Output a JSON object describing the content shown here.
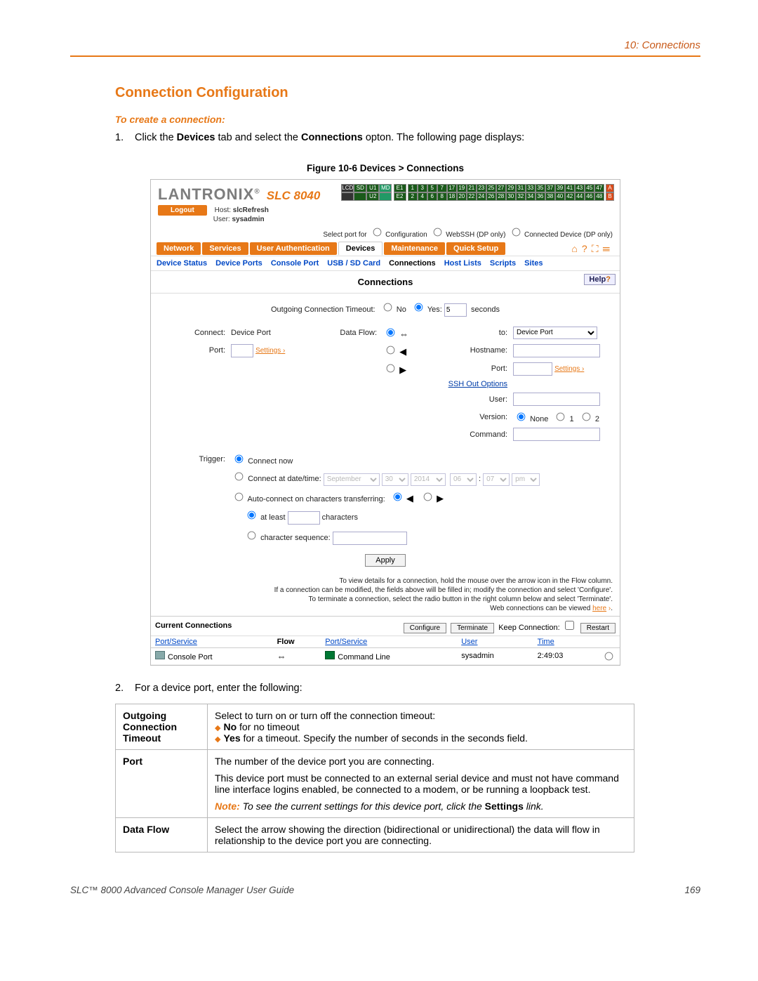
{
  "chapter": "10: Connections",
  "section_title": "Connection Configuration",
  "subhead": "To create a connection:",
  "step1": {
    "num": "1.",
    "pre": "Click the ",
    "b1": "Devices",
    "mid": " tab and select the ",
    "b2": "Connections",
    "post": " opton. The following page displays:"
  },
  "figcap": "Figure 10-6  Devices > Connections",
  "shot": {
    "logo_brand": "LANTRONIX",
    "logo_model": "SLC 8040",
    "logout": "Logout",
    "host_lbl": "Host:",
    "host_val": "slcRefresh",
    "user_lbl": "User:",
    "user_val": "sysadmin",
    "grid": {
      "lcd": "LCD",
      "sd": "SD",
      "u1": "U1",
      "u2": "U2",
      "md": "MD",
      "e1": "E1",
      "e2": "E2",
      "row1": [
        "1",
        "3",
        "5",
        "7",
        "17",
        "19",
        "21",
        "23",
        "25",
        "27",
        "29",
        "31",
        "33",
        "35",
        "37",
        "39",
        "41",
        "43",
        "45",
        "47"
      ],
      "row2": [
        "2",
        "4",
        "6",
        "8",
        "18",
        "20",
        "22",
        "24",
        "26",
        "28",
        "30",
        "32",
        "34",
        "36",
        "38",
        "40",
        "42",
        "44",
        "46",
        "48"
      ],
      "capA": "A",
      "capB": "B"
    },
    "selport": {
      "lbl": "Select port for",
      "o1": "Configuration",
      "o2": "WebSSH (DP only)",
      "o3": "Connected Device (DP only)"
    },
    "tabs": [
      "Network",
      "Services",
      "User Authentication",
      "Devices",
      "Maintenance",
      "Quick Setup"
    ],
    "tab_current": 3,
    "subtabs": [
      "Device Status",
      "Device Ports",
      "Console Port",
      "USB / SD Card",
      "Connections",
      "Host Lists",
      "Scripts",
      "Sites"
    ],
    "subtab_current": 4,
    "panel_title": "Connections",
    "help": "Help",
    "oct": {
      "lbl": "Outgoing Connection Timeout:",
      "no": "No",
      "yes": "Yes:",
      "val": "5",
      "unit": "seconds"
    },
    "left": {
      "connect_lbl": "Connect:",
      "connect_val": "Device Port",
      "port_lbl": "Port:",
      "settings": "Settings"
    },
    "flow_lbl": "Data Flow:",
    "right": {
      "to_lbl": "to:",
      "to_val": "Device Port",
      "host_lbl": "Hostname:",
      "port_lbl": "Port:",
      "settings": "Settings",
      "sshopt": "SSH Out Options",
      "user_lbl": "User:",
      "ver_lbl": "Version:",
      "ver_none": "None",
      "ver_1": "1",
      "ver_2": "2",
      "cmd_lbl": "Command:"
    },
    "trigger": {
      "lbl": "Trigger:",
      "now": "Connect now",
      "at": "Connect at date/time:",
      "month": "September",
      "day": "30",
      "year": "2014",
      "hh": "06",
      "mm": "07",
      "ampm": "pm",
      "auto": "Auto-connect on characters transferring:",
      "atleast": "at least",
      "chars": "characters",
      "seq": "character sequence:"
    },
    "apply": "Apply",
    "hints": {
      "l1": "To view details for a connection, hold the mouse over the arrow icon in the Flow column.",
      "l2": "If a connection can be modified, the fields above will be filled in; modify the connection and select 'Configure'.",
      "l3": "To terminate a connection, select the radio button in the right column below and select 'Terminate'.",
      "l4a": "Web connections can be viewed ",
      "l4b": "here"
    },
    "cc": {
      "title": "Current Connections",
      "configure": "Configure",
      "terminate": "Terminate",
      "keep": "Keep Connection:",
      "restart": "Restart",
      "cols": {
        "ps": "Port/Service",
        "flow": "Flow",
        "ps2": "Port/Service",
        "user": "User",
        "time": "Time"
      },
      "row": {
        "ps": "Console Port",
        "ps2": "Command Line",
        "user": "sysadmin",
        "time": "2:49:03"
      }
    }
  },
  "step2": {
    "num": "2.",
    "text": "For a device port, enter the following:"
  },
  "defs": {
    "oct": {
      "k": "Outgoing Connection Timeout",
      "lead": "Select to turn on or turn off the connection timeout:",
      "li1a": "No",
      "li1b": " for no timeout",
      "li2a": "Yes",
      "li2b": " for a timeout.  Specify the number of seconds in the seconds field."
    },
    "port": {
      "k": "Port",
      "p1": "The number of the device port you are connecting.",
      "p2": "This device port must be connected to an external serial device and must not have command line interface logins enabled, be connected to a modem, or be running a loopback test.",
      "note_lbl": "Note:",
      "note_txt": "  To see the current settings for this device port, click the ",
      "note_b": "Settings",
      "note_end": " link."
    },
    "flow": {
      "k": "Data Flow",
      "p": "Select the arrow showing the direction (bidirectional or unidirectional) the data will flow in relationship to the device port you are connecting."
    }
  },
  "footer_left": "SLC™ 8000 Advanced Console Manager User Guide",
  "footer_right": "169"
}
